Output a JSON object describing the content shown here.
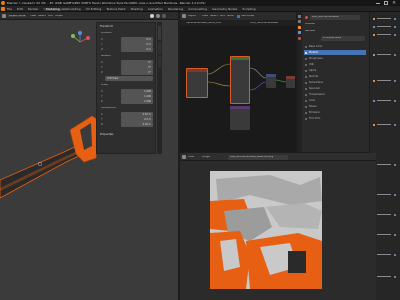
{
  "window": {
    "title": "Blender [...tzeuta/rx_00_MX_...EX_JXDB_GAMEYAP95_PUBTO Handy Workshop Tools Fan400M...klge s.rsnert/facl Memlines...Blender 4.2.0 LTS]"
  },
  "menu": {
    "items": [
      "File",
      "Edit",
      "Render",
      "Window",
      "Help"
    ],
    "workspace_tabs": [
      "Modeling",
      "Sculpting",
      "UV Editing",
      "Texture Paint",
      "Shading",
      "Animation",
      "Rendering",
      "Compositing",
      "Geometry Nodes",
      "Scripting"
    ],
    "active_workspace": "Modeling"
  },
  "viewport": {
    "mode": "Object Mode",
    "header_items": [
      "View",
      "Select",
      "Add",
      "Object"
    ],
    "n_panel": {
      "transform_header": "Transform",
      "location_header": "Location",
      "rotation_header": "Rotation",
      "mode_label": "XYZ Euler",
      "scale_header": "Scale",
      "dimensions_header": "Dimensions",
      "properties_header": "Properties",
      "axes": [
        "X",
        "Y",
        "Z"
      ],
      "location": [
        "0 m",
        "0 m",
        "0 m"
      ],
      "rotation": [
        "0°",
        "0°",
        "0°"
      ],
      "scale": [
        "1.000",
        "1.000",
        "1.000"
      ],
      "dimensions": [
        "0.67 m",
        "0.2 m",
        "0.02 m"
      ]
    }
  },
  "node_editor": {
    "header_items": [
      "Object",
      "View",
      "Select",
      "Add",
      "Node",
      "Use Nodes"
    ],
    "breadcrumb": [
      "Hammerhandsaw_Wood_Low",
      "Core_Hammerhandsaw"
    ]
  },
  "image_editor": {
    "header_items": [
      "View",
      "Image"
    ],
    "image_name": "saw_hammerhandsaw_BaseColor.png"
  },
  "properties": {
    "material_name": "saw_hammerhandsaw",
    "surface_label": "Surface",
    "shader": "Principled BSDF",
    "preview_label": "Preview",
    "rows": [
      "Base Color",
      "Metallic",
      "Roughness",
      "IOR",
      "Alpha",
      "Normal",
      "Subsurface",
      "Specular",
      "Transmission",
      "Coat",
      "Sheen",
      "Emission",
      "Thin Film"
    ]
  },
  "colors": {
    "accent_selection": "#4772b3",
    "object_orange": "#e65f12",
    "texture_grey": "#c9c9c9",
    "node_header_red": "#7a3b2e"
  }
}
